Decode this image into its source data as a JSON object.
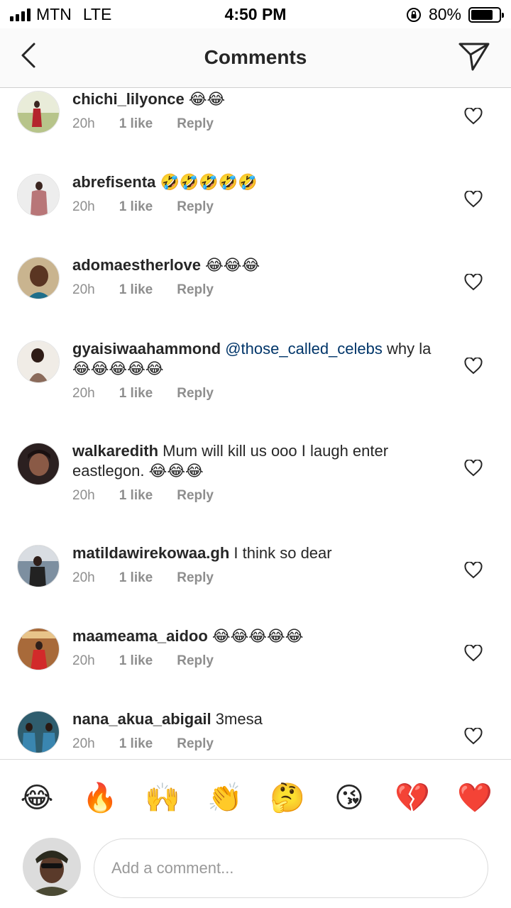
{
  "status_bar": {
    "carrier": "MTN",
    "network": "LTE",
    "time": "4:50 PM",
    "battery_percent": "80%",
    "battery_level": 0.8
  },
  "header": {
    "title": "Comments",
    "back_icon": "chevron-left-icon",
    "send_icon": "paper-plane-icon"
  },
  "comments": [
    {
      "username": "chichi_lilyonce",
      "text": " 😂😂",
      "time": "20h",
      "likes": "1 like",
      "reply": "Reply"
    },
    {
      "username": "abrefisenta",
      "text": " 🤣🤣🤣🤣🤣",
      "time": "20h",
      "likes": "1 like",
      "reply": "Reply"
    },
    {
      "username": "adomaestherlove",
      "text": " 😂😂😂",
      "time": "20h",
      "likes": "1 like",
      "reply": "Reply"
    },
    {
      "username": "gyaisiwaahammond",
      "mention": " @those_called_celebs",
      "text": " why la😂😂😂😂😂",
      "time": "20h",
      "likes": "1 like",
      "reply": "Reply"
    },
    {
      "username": "walkaredith",
      "text": " Mum will kill us ooo I laugh enter eastlegon. 😂😂😂",
      "time": "20h",
      "likes": "1 like",
      "reply": "Reply"
    },
    {
      "username": "matildawirekowaa.gh",
      "text": " I think so dear",
      "time": "20h",
      "likes": "1 like",
      "reply": "Reply"
    },
    {
      "username": "maameama_aidoo",
      "text": " 😂😂😂😂😂",
      "time": "20h",
      "likes": "1 like",
      "reply": "Reply"
    },
    {
      "username": "nana_akua_abigail",
      "text": " 3mesa",
      "time": "20h",
      "likes": "1 like",
      "reply": "Reply"
    }
  ],
  "emoji_bar": [
    "😂",
    "🔥",
    "🙌",
    "👏",
    "🤔",
    "😘",
    "💔",
    "❤️"
  ],
  "composer": {
    "placeholder": "Add a comment..."
  },
  "colors": {
    "username": "#262626",
    "meta": "#8e8e8e",
    "mention": "#003569",
    "divider": "#dbdbdb"
  }
}
